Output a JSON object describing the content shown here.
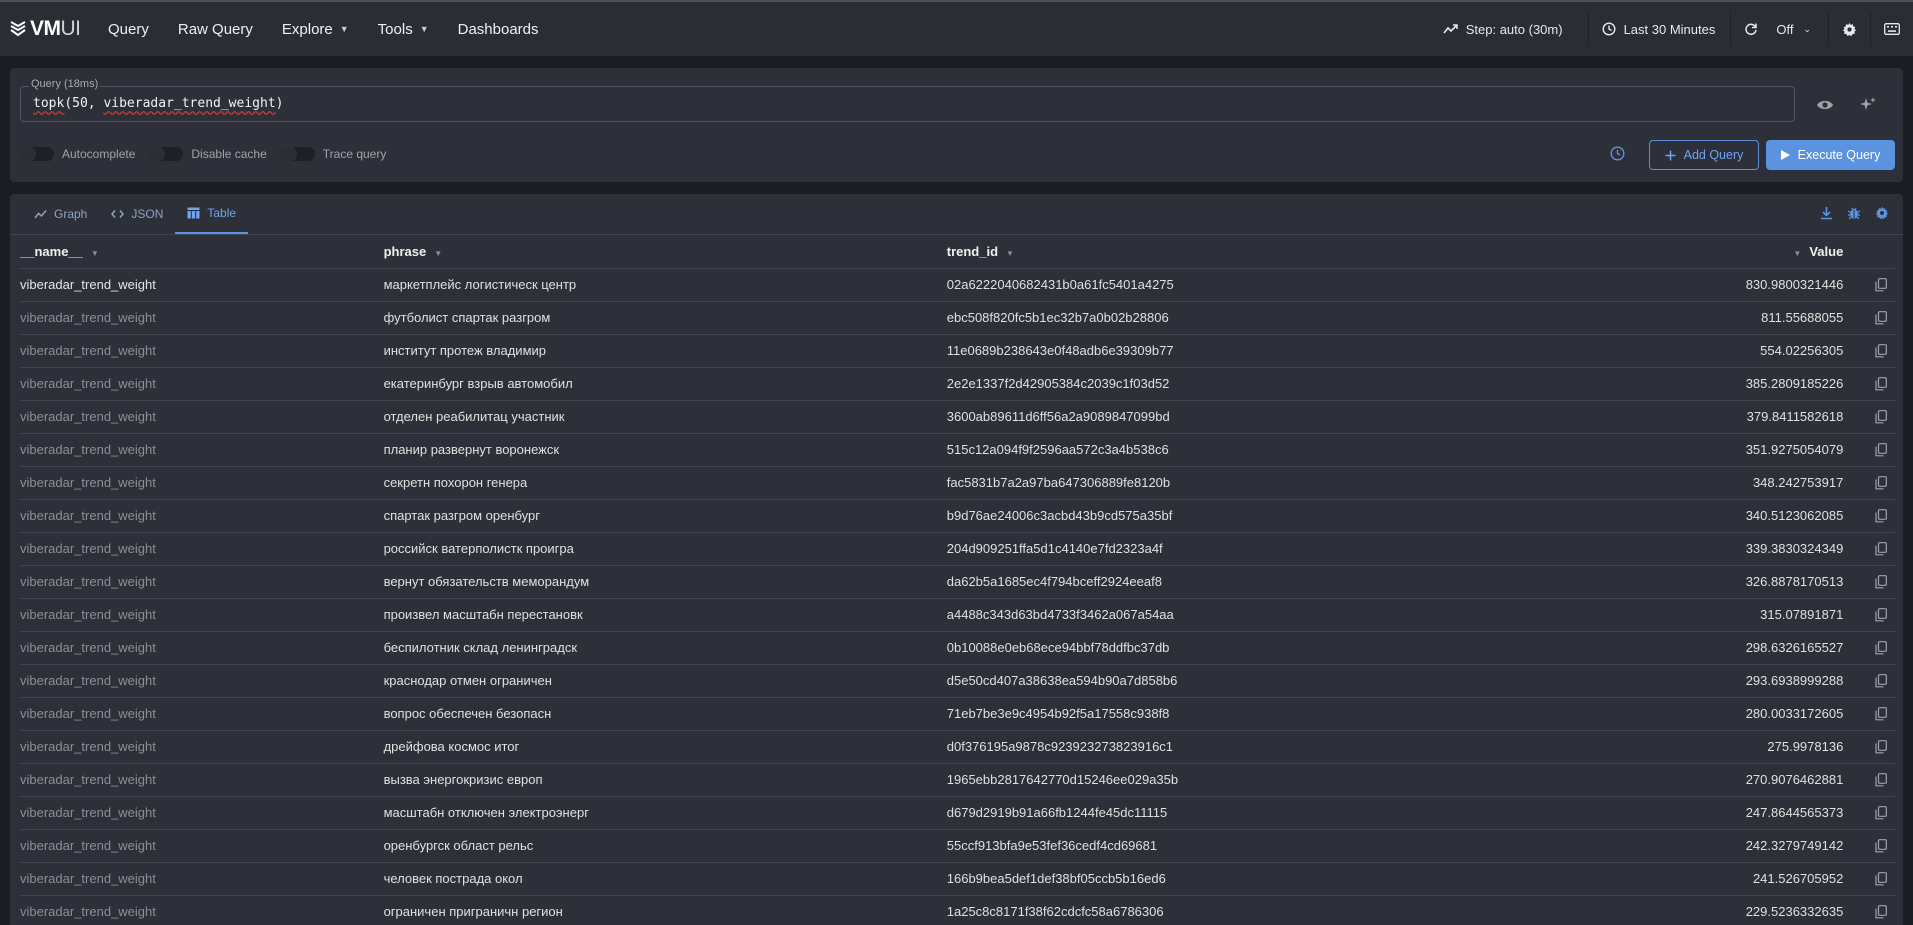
{
  "header": {
    "logo_bold": "VM",
    "logo_light": "UI",
    "nav": [
      {
        "label": "Query",
        "has_caret": false
      },
      {
        "label": "Raw Query",
        "has_caret": false
      },
      {
        "label": "Explore",
        "has_caret": true
      },
      {
        "label": "Tools",
        "has_caret": true
      },
      {
        "label": "Dashboards",
        "has_caret": false
      }
    ],
    "step_label": "Step: auto (30m)",
    "time_range_label": "Last 30 Minutes",
    "refresh_label": "Off"
  },
  "query": {
    "label": "Query (18ms)",
    "fn": "topk",
    "args_prefix": "(50, ",
    "metric": "viberadar_trend_weight",
    "args_suffix": ")",
    "toggles": [
      "Autocomplete",
      "Disable cache",
      "Trace query"
    ],
    "add_query_label": "Add Query",
    "execute_label": "Execute Query"
  },
  "tabs": [
    {
      "label": "Graph",
      "icon": "graph-icon",
      "active": false
    },
    {
      "label": "JSON",
      "icon": "code-icon",
      "active": false
    },
    {
      "label": "Table",
      "icon": "table-icon",
      "active": true
    }
  ],
  "table": {
    "columns": [
      "__name__",
      "phrase",
      "trend_id",
      "Value"
    ],
    "rows": [
      {
        "name": "viberadar_trend_weight",
        "phrase": "маркетплейс логистическ центр",
        "trend_id": "02a6222040682431b0a61fc5401a4275",
        "value": "830.9800321446"
      },
      {
        "name": "viberadar_trend_weight",
        "phrase": "футболист спартак разгром",
        "trend_id": "ebc508f820fc5b1ec32b7a0b02b28806",
        "value": "811.55688055"
      },
      {
        "name": "viberadar_trend_weight",
        "phrase": "институт протеж владимир",
        "trend_id": "11e0689b238643e0f48adb6e39309b77",
        "value": "554.02256305"
      },
      {
        "name": "viberadar_trend_weight",
        "phrase": "екатеринбург взрыв автомобил",
        "trend_id": "2e2e1337f2d42905384c2039c1f03d52",
        "value": "385.2809185226"
      },
      {
        "name": "viberadar_trend_weight",
        "phrase": "отделен реабилитац участник",
        "trend_id": "3600ab89611d6ff56a2a9089847099bd",
        "value": "379.8411582618"
      },
      {
        "name": "viberadar_trend_weight",
        "phrase": "планир развернут воронежск",
        "trend_id": "515c12a094f9f2596aa572c3a4b538c6",
        "value": "351.9275054079"
      },
      {
        "name": "viberadar_trend_weight",
        "phrase": "секретн похорон генера",
        "trend_id": "fac5831b7a2a97ba647306889fe8120b",
        "value": "348.242753917"
      },
      {
        "name": "viberadar_trend_weight",
        "phrase": "спартак разгром оренбург",
        "trend_id": "b9d76ae24006c3acbd43b9cd575a35bf",
        "value": "340.5123062085"
      },
      {
        "name": "viberadar_trend_weight",
        "phrase": "российск ватерполистк проигра",
        "trend_id": "204d909251ffa5d1c4140e7fd2323a4f",
        "value": "339.3830324349"
      },
      {
        "name": "viberadar_trend_weight",
        "phrase": "вернут обязательств меморандум",
        "trend_id": "da62b5a1685ec4f794bceff2924eeaf8",
        "value": "326.8878170513"
      },
      {
        "name": "viberadar_trend_weight",
        "phrase": "произвел масштабн перестановк",
        "trend_id": "a4488c343d63bd4733f3462a067a54aa",
        "value": "315.07891871"
      },
      {
        "name": "viberadar_trend_weight",
        "phrase": "беспилотник склад ленинградск",
        "trend_id": "0b10088e0eb68ece94bbf78ddfbc37db",
        "value": "298.6326165527"
      },
      {
        "name": "viberadar_trend_weight",
        "phrase": "краснодар отмен ограничен",
        "trend_id": "d5e50cd407a38638ea594b90a7d858b6",
        "value": "293.6938999288"
      },
      {
        "name": "viberadar_trend_weight",
        "phrase": "вопрос обеспечен безопасн",
        "trend_id": "71eb7be3e9c4954b92f5a17558c938f8",
        "value": "280.0033172605"
      },
      {
        "name": "viberadar_trend_weight",
        "phrase": "дрейфова космос итог",
        "trend_id": "d0f376195a9878c923923273823916c1",
        "value": "275.9978136"
      },
      {
        "name": "viberadar_trend_weight",
        "phrase": "вызва энергокризис европ",
        "trend_id": "1965ebb2817642770d15246ee029a35b",
        "value": "270.9076462881"
      },
      {
        "name": "viberadar_trend_weight",
        "phrase": "масштабн отключен электроэнерг",
        "trend_id": "d679d2919b91a66fb1244fe45dc11115",
        "value": "247.8644565373"
      },
      {
        "name": "viberadar_trend_weight",
        "phrase": "оренбургск област рельс",
        "trend_id": "55ccf913bfa9e53fef36cedf4cd69681",
        "value": "242.3279749142"
      },
      {
        "name": "viberadar_trend_weight",
        "phrase": "человек пострада окол",
        "trend_id": "166b9bea5def1def38bf05ccb5b16ed6",
        "value": "241.526705952"
      },
      {
        "name": "viberadar_trend_weight",
        "phrase": "ограничен приграничн регион",
        "trend_id": "1a25c8c8171f38f62cdcfc58a6786306",
        "value": "229.5236332635"
      }
    ]
  }
}
